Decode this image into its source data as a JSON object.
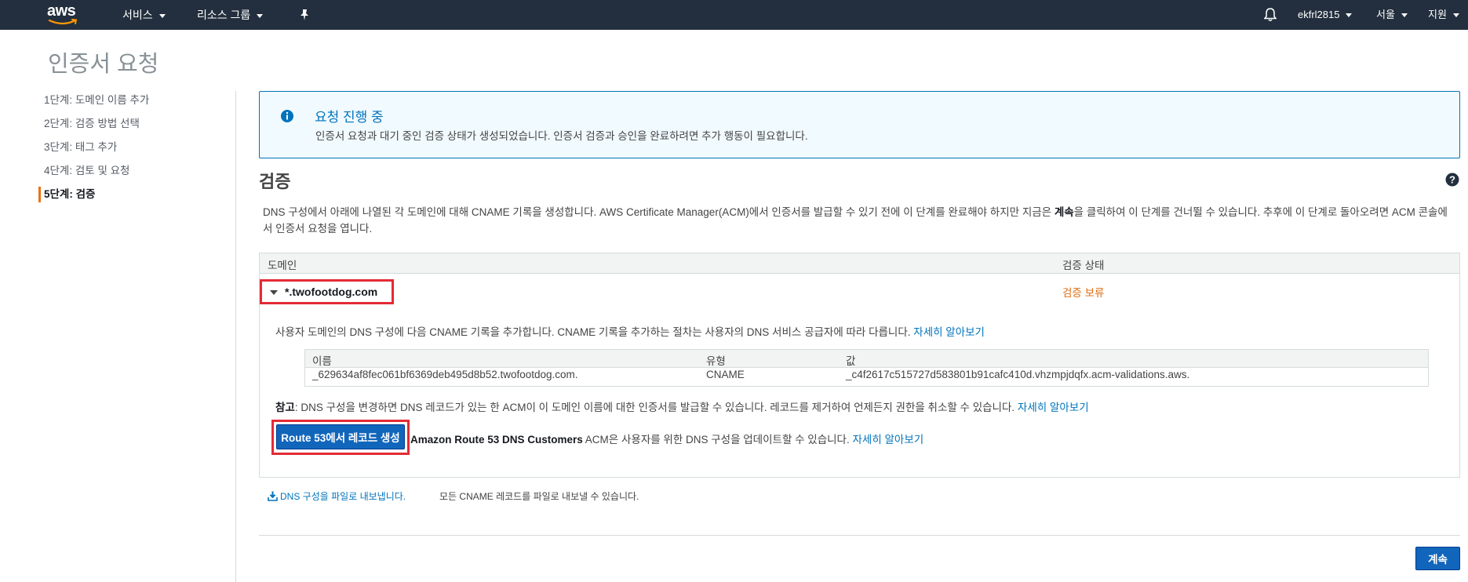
{
  "header": {
    "logo": "aws",
    "services": "서비스",
    "resource_groups": "리소스 그룹",
    "account": "ekfrl2815",
    "region": "서울",
    "support": "지원",
    "icons": [
      "pin-icon",
      "bell-icon"
    ]
  },
  "page": {
    "title": "인증서 요청"
  },
  "steps": [
    {
      "label": "1단계: 도메인 이름 추가"
    },
    {
      "label": "2단계: 검증 방법 선택"
    },
    {
      "label": "3단계: 태그 추가"
    },
    {
      "label": "4단계: 검토 및 요청"
    },
    {
      "label": "5단계: 검증",
      "active": true
    }
  ],
  "alert": {
    "title": "요청 진행 중",
    "text": "인증서 요청과 대기 중인 검증 상태가 생성되었습니다. 인증서 검증과 승인을 완료하려면 추가 행동이 필요합니다."
  },
  "validation": {
    "title": "검증",
    "desc_before": "DNS 구성에서 아래에 나열된 각 도메인에 대해 CNAME 기록을 생성합니다. AWS Certificate Manager(ACM)에서 인증서를 발급할 수 있기 전에 이 단계를 완료해야 하지만 지금은 ",
    "desc_bold": "계속",
    "desc_after": "을 클릭하여 이 단계를 건너뛸 수 있습니다. 추후에 이 단계로 돌아오려면 ACM 콘솔에서 인증서 요청을 엽니다."
  },
  "domain_table": {
    "col_domain": "도메인",
    "col_status": "검증 상태",
    "domain": "*.twofootdog.com",
    "status": "검증 보류",
    "hint": "사용자 도메인의 DNS 구성에 다음 CNAME 기록을 추가합니다. CNAME 기록을 추가하는 절차는 사용자의 DNS 서비스 공급자에 따라 다릅니다.",
    "hint_link": "자세히 알아보기"
  },
  "cname_table": {
    "col_name": "이름",
    "col_type": "유형",
    "col_value": "값",
    "row": {
      "name": "_629634af8fec061bf6369deb495d8b52.twofootdog.com.",
      "type": "CNAME",
      "value": "_c4f2617c515727d583801b91cafc410d.vhzmpjdqfx.acm-validations.aws."
    }
  },
  "note": {
    "label": "참고",
    "text": ": DNS 구성을 변경하면 DNS 레코드가 있는 한 ACM이 이 도메인 이름에 대한 인증서를 발급할 수 있습니다. 레코드를 제거하여 언제든지 권한을 취소할 수 있습니다.",
    "link": "자세히 알아보기"
  },
  "route53": {
    "button": "Route 53에서 레코드 생성",
    "bold": "Amazon Route 53 DNS Customers",
    "text": " ACM은 사용자를 위한 DNS 구성을 업데이트할 수 있습니다.",
    "link": "자세히 알아보기"
  },
  "export": {
    "link": "DNS 구성을 파일로 내보냅니다.",
    "desc": "모든 CNAME 레코드를 파일로 내보낼 수 있습니다."
  },
  "footer": {
    "continue": "계속"
  },
  "colors": {
    "nav_bg": "#232f3e",
    "accent_orange": "#ec7211",
    "link_blue": "#0073bb",
    "button_blue": "#1166bb",
    "highlight_red": "#e32b35",
    "pending_orange": "#dd6b10"
  }
}
